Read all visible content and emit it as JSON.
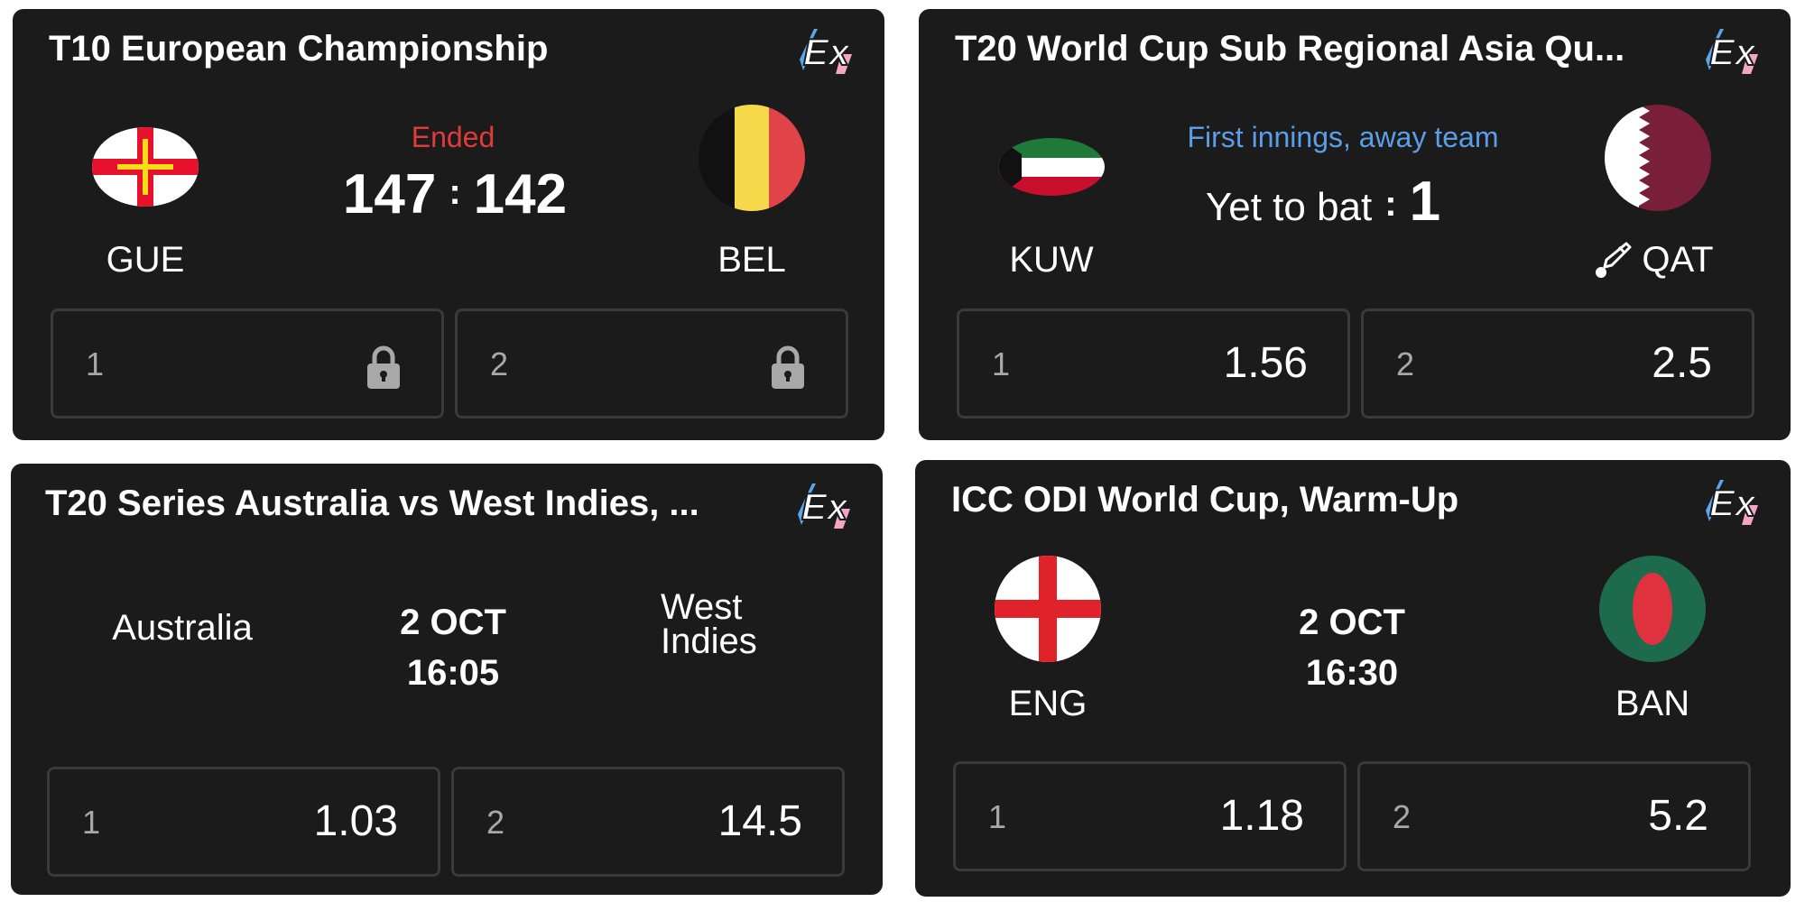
{
  "cards": [
    {
      "title": "T10 European Championship",
      "status": "Ended",
      "home": {
        "code": "GUE"
      },
      "away": {
        "code": "BEL"
      },
      "score_home": "147",
      "score_sep": ":",
      "score_away": "142",
      "odds": [
        {
          "label": "1",
          "locked": true
        },
        {
          "label": "2",
          "locked": true
        }
      ]
    },
    {
      "title": "T20 World Cup Sub Regional Asia Qu...",
      "status": "First innings, away team",
      "home": {
        "code": "KUW"
      },
      "away": {
        "code": "QAT",
        "batting": true
      },
      "score_home": "Yet to bat",
      "score_sep": ":",
      "score_away": "1",
      "odds": [
        {
          "label": "1",
          "value": "1.56"
        },
        {
          "label": "2",
          "value": "2.5"
        }
      ]
    },
    {
      "title": "T20 Series Australia vs West Indies, ...",
      "home": {
        "name": "Australia"
      },
      "away": {
        "name_line1": "West",
        "name_line2": "Indies"
      },
      "date": "2 OCT",
      "time": "16:05",
      "odds": [
        {
          "label": "1",
          "value": "1.03"
        },
        {
          "label": "2",
          "value": "14.5"
        }
      ]
    },
    {
      "title": "ICC ODI World Cup, Warm-Up",
      "home": {
        "code": "ENG"
      },
      "away": {
        "code": "BAN"
      },
      "date": "2 OCT",
      "time": "16:30",
      "odds": [
        {
          "label": "1",
          "value": "1.18"
        },
        {
          "label": "2",
          "value": "5.2"
        }
      ]
    }
  ],
  "colors": {
    "card_bg": "#1b1b1b",
    "ended": "#e03b3b",
    "live_status": "#5a9ee8",
    "border": "#3a3a3a"
  },
  "icons": [
    "ex-logo-icon",
    "lock-icon",
    "cricket-bat-icon"
  ]
}
